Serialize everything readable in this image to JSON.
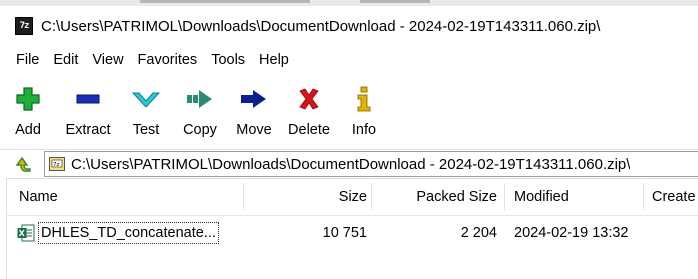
{
  "window": {
    "title": "C:\\Users\\PATRIMOL\\Downloads\\DocumentDownload - 2024-02-19T143311.060.zip\\",
    "app_icon_text": "7z"
  },
  "menu": {
    "items": [
      {
        "label": "File"
      },
      {
        "label": "Edit"
      },
      {
        "label": "View"
      },
      {
        "label": "Favorites"
      },
      {
        "label": "Tools"
      },
      {
        "label": "Help"
      }
    ]
  },
  "toolbar": {
    "buttons": [
      {
        "label": "Add",
        "icon": "plus-icon"
      },
      {
        "label": "Extract",
        "icon": "minus-icon"
      },
      {
        "label": "Test",
        "icon": "check-icon"
      },
      {
        "label": "Copy",
        "icon": "double-arrow-icon"
      },
      {
        "label": "Move",
        "icon": "arrow-right-icon"
      },
      {
        "label": "Delete",
        "icon": "x-icon"
      },
      {
        "label": "Info",
        "icon": "info-icon"
      }
    ]
  },
  "address": {
    "path": "C:\\Users\\PATRIMOL\\Downloads\\DocumentDownload - 2024-02-19T143311.060.zip\\"
  },
  "file_list": {
    "columns": [
      "Name",
      "Size",
      "Packed Size",
      "Modified",
      "Create"
    ],
    "rows": [
      {
        "name": "DHLES_TD_concatenate...",
        "size": "10 751",
        "packed_size": "2 204",
        "modified": "2024-02-19 13:32",
        "icon": "excel-file-icon"
      }
    ]
  },
  "colors": {
    "add_green": "#1fae3a",
    "extract_blue": "#1a2fb5",
    "test_cyan": "#2ec7d8",
    "copy_teal": "#2b8a78",
    "move_navy": "#0b1f8f",
    "delete_red": "#d7141a",
    "info_yellow": "#e0b400",
    "excel_green": "#1e7145"
  }
}
